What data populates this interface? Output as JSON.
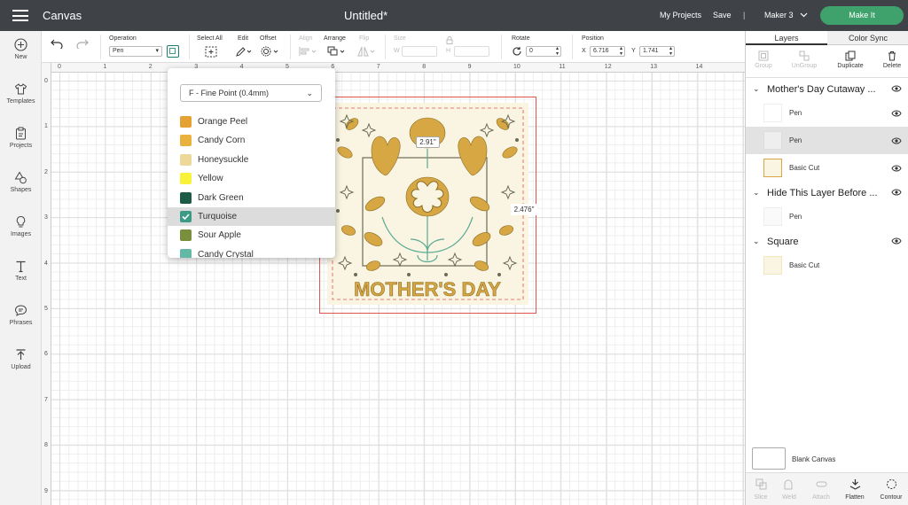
{
  "topbar": {
    "app_title": "Canvas",
    "doc_title": "Untitled*",
    "my_projects": "My Projects",
    "save": "Save",
    "separator": "|",
    "machine": "Maker 3",
    "make_it": "Make It"
  },
  "sidebar": [
    {
      "label": "New",
      "icon": "plus-circle-icon"
    },
    {
      "label": "Templates",
      "icon": "shirt-icon"
    },
    {
      "label": "Projects",
      "icon": "clipboard-icon"
    },
    {
      "label": "Shapes",
      "icon": "shapes-icon"
    },
    {
      "label": "Images",
      "icon": "lightbulb-icon"
    },
    {
      "label": "Text",
      "icon": "text-icon"
    },
    {
      "label": "Phrases",
      "icon": "speech-bubble-icon"
    },
    {
      "label": "Upload",
      "icon": "upload-icon"
    }
  ],
  "toolbar": {
    "operation_label": "Operation",
    "operation_value": "Pen",
    "select_all": "Select All",
    "edit": "Edit",
    "offset": "Offset",
    "align": "Align",
    "arrange": "Arrange",
    "flip": "Flip",
    "size": "Size",
    "w": "W",
    "h": "H",
    "rotate": "Rotate",
    "rotate_value": "0",
    "position": "Position",
    "x_label": "X",
    "x_value": "6.716",
    "y_label": "Y",
    "y_value": "1.741"
  },
  "rulers": {
    "h": [
      "0",
      "1",
      "2",
      "3",
      "4",
      "5",
      "6",
      "7",
      "8",
      "9",
      "10",
      "11",
      "12",
      "13",
      "14"
    ],
    "v": [
      "0",
      "1",
      "2",
      "3",
      "4",
      "5",
      "6",
      "7",
      "8",
      "9"
    ]
  },
  "canvas": {
    "dim_width": "2.91\"",
    "dim_height": "2.476\"",
    "design_text": "MOTHER'S DAY"
  },
  "pen_dropdown": {
    "selected": "F - Fine Point (0.4mm)",
    "colors": [
      {
        "name": "Orange Peel",
        "color": "#e3a232"
      },
      {
        "name": "Candy Corn",
        "color": "#e8b23c"
      },
      {
        "name": "Honeysuckle",
        "color": "#ecd99a"
      },
      {
        "name": "Yellow",
        "color": "#f9f23a"
      },
      {
        "name": "Dark Green",
        "color": "#1e5b44"
      },
      {
        "name": "Turquoise",
        "color": "#3d9b85",
        "checked": true
      },
      {
        "name": "Sour Apple",
        "color": "#7a8f3c"
      },
      {
        "name": "Candy Crystal",
        "color": "#63b9a5"
      }
    ]
  },
  "layers_panel": {
    "tabs": [
      "Layers",
      "Color Sync"
    ],
    "tools": [
      "Group",
      "UnGroup",
      "Duplicate",
      "Delete"
    ],
    "groups": [
      {
        "title": "Mother's Day Cutaway ...",
        "items": [
          "Pen",
          "Pen",
          "Basic Cut"
        ]
      },
      {
        "title": "Hide This Layer Before ...",
        "items": [
          "Pen"
        ]
      },
      {
        "title": "Square",
        "items": [
          "Basic Cut"
        ]
      }
    ],
    "blank_canvas": "Blank Canvas",
    "bottom_tools": [
      "Slice",
      "Weld",
      "Attach",
      "Flatten",
      "Contour"
    ]
  }
}
